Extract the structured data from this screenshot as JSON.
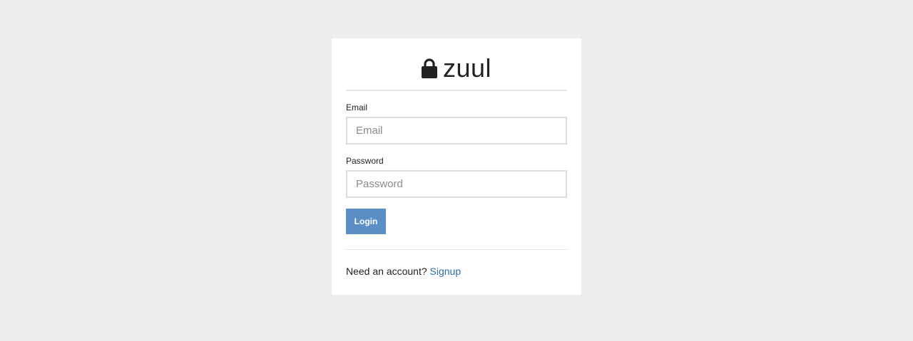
{
  "brand": {
    "name": "zuul",
    "icon": "lock-icon"
  },
  "form": {
    "email": {
      "label": "Email",
      "placeholder": "Email",
      "value": ""
    },
    "password": {
      "label": "Password",
      "placeholder": "Password",
      "value": ""
    },
    "login_label": "Login"
  },
  "footer": {
    "prompt": "Need an account?",
    "signup_label": "Signup"
  },
  "colors": {
    "background": "#ededed",
    "card": "#ffffff",
    "button": "#5b8ec4",
    "link": "#2e6da4"
  }
}
